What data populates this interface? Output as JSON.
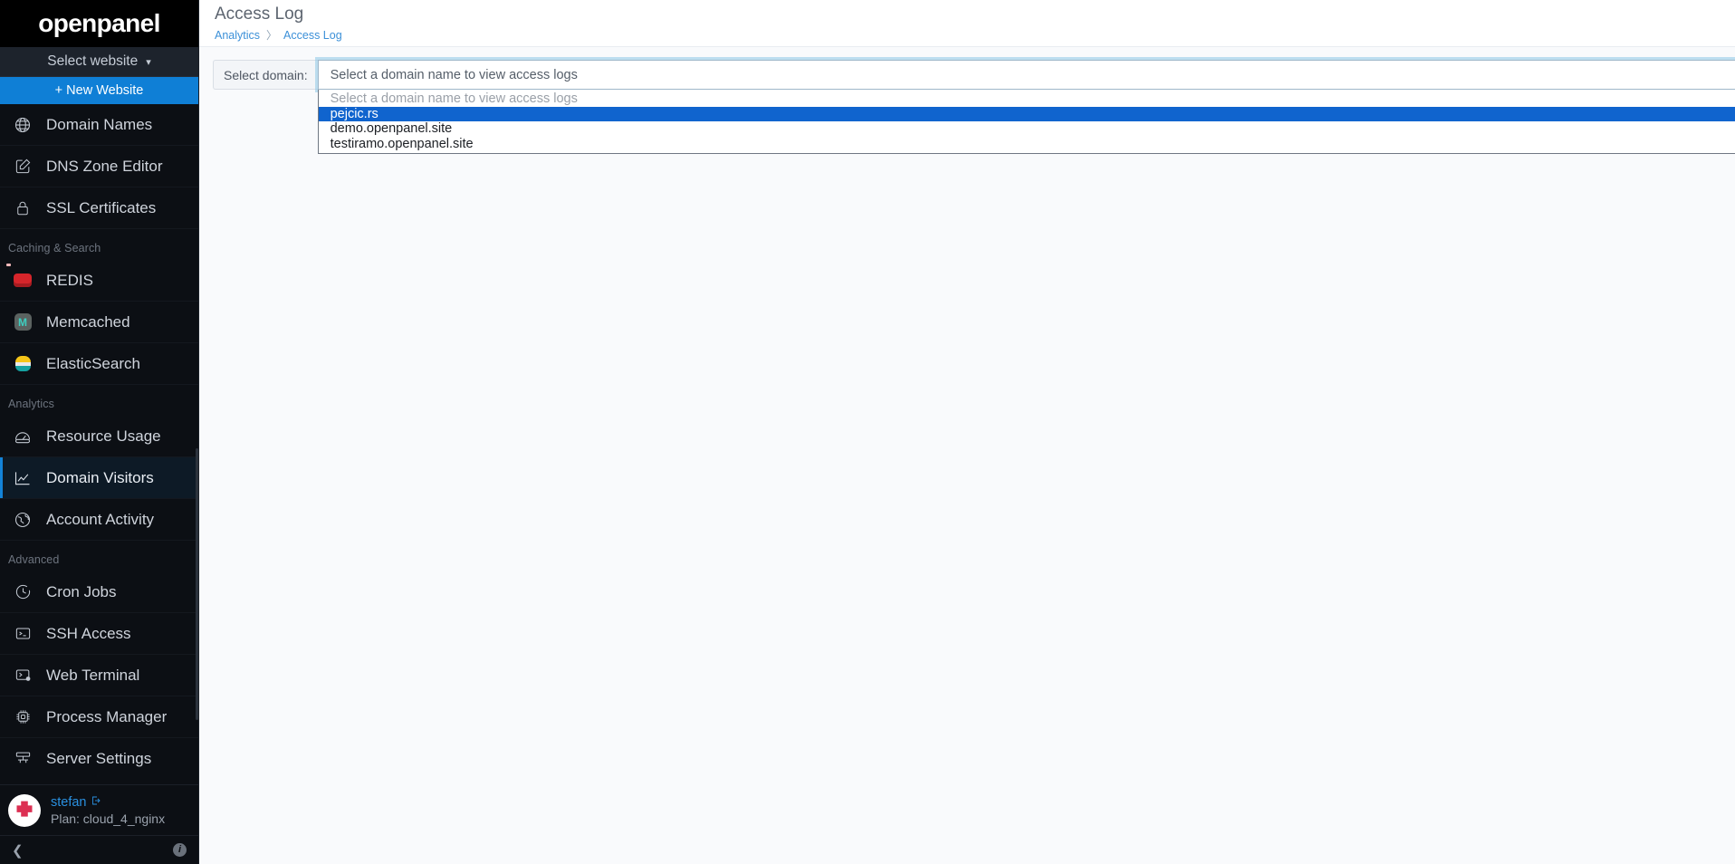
{
  "sidebar": {
    "brand": "openpanel",
    "website_selector": {
      "label": "Select website",
      "icon": "chevron-down-icon"
    },
    "new_website_button": "+ New Website",
    "groups": [
      {
        "label": null,
        "items": [
          {
            "label": "Domain Names",
            "icon": "globe-icon",
            "active": false
          },
          {
            "label": "DNS Zone Editor",
            "icon": "edit-square-icon",
            "active": false
          },
          {
            "label": "SSL Certificates",
            "icon": "lock-icon",
            "active": false
          }
        ]
      },
      {
        "label": "Caching & Search",
        "items": [
          {
            "label": "REDIS",
            "icon": "redis-icon",
            "active": false
          },
          {
            "label": "Memcached",
            "icon": "memcached-icon",
            "active": false
          },
          {
            "label": "ElasticSearch",
            "icon": "elasticsearch-icon",
            "active": false
          }
        ]
      },
      {
        "label": "Analytics",
        "items": [
          {
            "label": "Resource Usage",
            "icon": "gauge-icon",
            "active": false
          },
          {
            "label": "Domain Visitors",
            "icon": "line-chart-icon",
            "active": true
          },
          {
            "label": "Account Activity",
            "icon": "globe-activity-icon",
            "active": false
          }
        ]
      },
      {
        "label": "Advanced",
        "items": [
          {
            "label": "Cron Jobs",
            "icon": "clock-icon",
            "active": false
          },
          {
            "label": "SSH Access",
            "icon": "terminal-icon",
            "active": false
          },
          {
            "label": "Web Terminal",
            "icon": "web-terminal-icon",
            "active": false
          },
          {
            "label": "Process Manager",
            "icon": "cpu-icon",
            "active": false
          },
          {
            "label": "Server Settings",
            "icon": "server-icon",
            "active": false
          }
        ]
      }
    ],
    "user": {
      "name": "stefan",
      "logout_icon": "logout-icon",
      "plan": "Plan: cloud_4_nginx",
      "avatar": "user-avatar"
    },
    "footer": {
      "collapse_icon": "chevron-left-icon",
      "info_icon": "info-icon"
    }
  },
  "header": {
    "title": "Access Log",
    "breadcrumb": [
      "Analytics",
      "Access Log"
    ],
    "breadcrumb_separator": "〉",
    "search_icon": "search-icon"
  },
  "form": {
    "label": "Select domain:",
    "select": {
      "value": "Select a domain name to view access logs",
      "chevron_icon": "chevron-down-icon",
      "expanded": true,
      "options": [
        {
          "label": "Select a domain name to view access logs",
          "placeholder": true,
          "selected": false
        },
        {
          "label": "pejcic.rs",
          "placeholder": false,
          "selected": true
        },
        {
          "label": "demo.openpanel.site",
          "placeholder": false,
          "selected": false
        },
        {
          "label": "testiramo.openpanel.site",
          "placeholder": false,
          "selected": false
        }
      ]
    }
  },
  "colors": {
    "accent_blue": "#0f7fd6",
    "selection_blue": "#1064ce",
    "sidebar_bg": "#0c0f14",
    "brand_bg": "#000000",
    "page_bg": "#f9fafc",
    "link_blue": "#3c90d8"
  }
}
